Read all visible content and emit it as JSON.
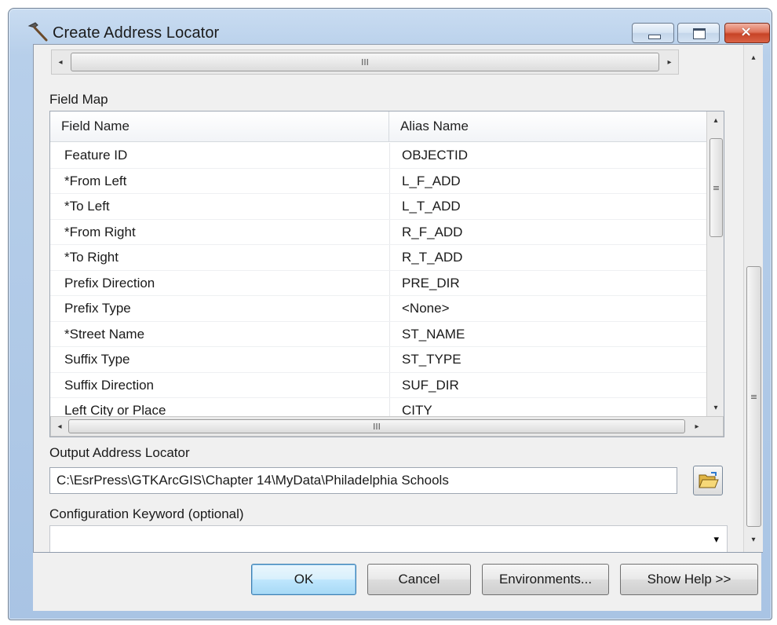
{
  "window": {
    "title": "Create Address Locator",
    "icon": "hammer-icon",
    "caption_buttons": {
      "minimize": "minimize-icon",
      "maximize": "maximize-icon",
      "close": "×"
    }
  },
  "scroll": {
    "left": "◂",
    "right": "▸",
    "up": "▴",
    "down": "▾",
    "grip_h": "III",
    "grip_v": "≡"
  },
  "field_map": {
    "label": "Field Map",
    "columns": [
      "Field Name",
      "Alias Name"
    ],
    "rows": [
      {
        "field": "Feature ID",
        "alias": "OBJECTID"
      },
      {
        "field": "*From Left",
        "alias": "L_F_ADD"
      },
      {
        "field": "*To Left",
        "alias": "L_T_ADD"
      },
      {
        "field": "*From Right",
        "alias": "R_F_ADD"
      },
      {
        "field": "*To Right",
        "alias": "R_T_ADD"
      },
      {
        "field": "Prefix Direction",
        "alias": "PRE_DIR"
      },
      {
        "field": "Prefix Type",
        "alias": "<None>"
      },
      {
        "field": "*Street Name",
        "alias": "ST_NAME"
      },
      {
        "field": "Suffix Type",
        "alias": "ST_TYPE"
      },
      {
        "field": "Suffix Direction",
        "alias": "SUF_DIR"
      },
      {
        "field": "Left City or Place",
        "alias": "CITY"
      }
    ]
  },
  "output": {
    "label": "Output Address Locator",
    "value": "C:\\EsrPress\\GTKArcGIS\\Chapter 14\\MyData\\Philadelphia Schools",
    "browse_icon": "open-folder-icon"
  },
  "config": {
    "label": "Configuration Keyword (optional)",
    "value": ""
  },
  "buttons": {
    "ok": "OK",
    "cancel": "Cancel",
    "environments": "Environments...",
    "help": "Show Help >>"
  },
  "colors": {
    "titlebar": "#b7cfea",
    "close_button": "#c84326",
    "dialog_bg": "#f0f0f0",
    "default_button_border": "#3c7fb1"
  }
}
